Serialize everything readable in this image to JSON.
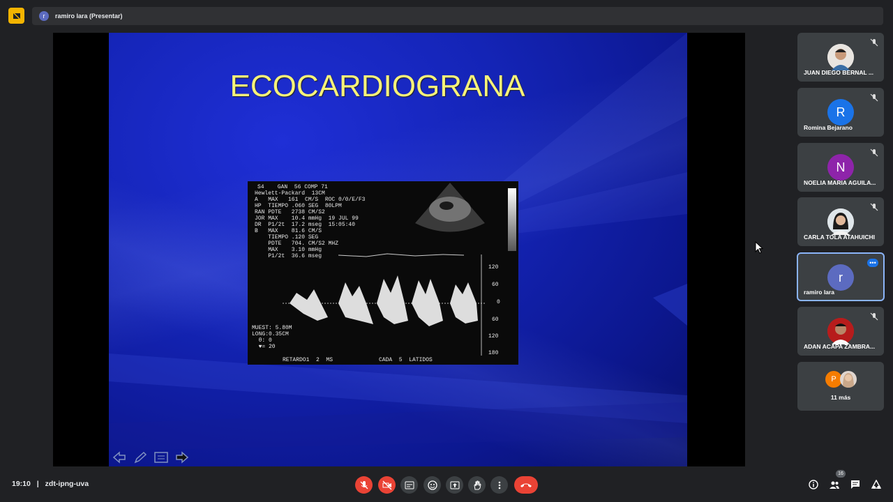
{
  "header": {
    "presenter_initial": "r",
    "presenter_label": "ramiro lara (Presentar)"
  },
  "slide": {
    "title": "ECOCARDIOGRANA",
    "echo": {
      "line1": "S4    GAN  56 COMP 71",
      "line2": "Hewlett-Packard  13CM",
      "line3": "A   MAX   161  CM/S  ROC 0/0/E/F3",
      "line4": "HP  TIEMPO .060 SEG  80LPM",
      "line5": "RAN PDTE   2738 CM/S2",
      "line6": "JOR MAX    10.4 mmHg  19 JUL 99",
      "line7": "DR  P1/2t  17.2 mseg  15:05:40",
      "line8": "B   MAX    81.6 CM/S",
      "line9": "    TIEMPO .120 SEG",
      "line10": "    PDTE   704. CM/S2 MHZ",
      "line11": "    MAX    3.10 mmHg",
      "line12": "    P1/2t  36.6 mseg",
      "scale": [
        "120",
        "60",
        "0",
        "60",
        "120",
        "180"
      ],
      "muest": "MUEST: 5.80M",
      "long": "LONG:0.35CM",
      "theta": "  θ: 0",
      "v": "  ♥= 20",
      "retardo": "RETARDO1  2  MS",
      "cada": "CADA  5  LATIDOS"
    }
  },
  "participants": [
    {
      "name": "JUAN DIEGO BERNAL ...",
      "initial": "",
      "color": "#c9cdd2"
    },
    {
      "name": "Romina Bejarano",
      "initial": "R",
      "color": "#1a73e8"
    },
    {
      "name": "NOELIA MARIA AGUILA...",
      "initial": "N",
      "color": "#8e24aa"
    },
    {
      "name": "CARLA TOLA ATAHUICHI",
      "initial": "",
      "color": "#d7ccc8"
    },
    {
      "name": "ramiro lara",
      "initial": "r",
      "color": "#5c6bc0"
    },
    {
      "name": "ADAN ACAPA ZAMBRA...",
      "initial": "",
      "color": "#c62828"
    },
    {
      "name": "11 más",
      "initial": "P",
      "color": "#f57c00"
    }
  ],
  "footer": {
    "time": "19:10",
    "separator": "|",
    "meeting_code": "zdt-ipng-uva",
    "people_count": "16"
  }
}
